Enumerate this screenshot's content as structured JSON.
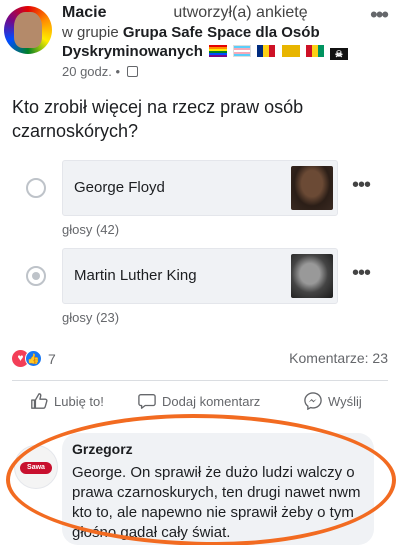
{
  "post": {
    "author_name": "Macie",
    "action_text": "utworzył(a) ankietę",
    "group_prefix": "w grupie",
    "group_name_line1": "Grupa Safe Space dla Osób",
    "group_name_line2": "Dyskryminowanych",
    "group_flags": [
      "rainbow-flag",
      "trans-flag",
      "romania-flag",
      "belgium-flag",
      "guinea-flag",
      "pirate-flag"
    ],
    "time": "20 godz.",
    "separator": "•",
    "question": "Kto zrobił więcej na rzecz praw osób czarnoskórych?"
  },
  "poll": {
    "options": [
      {
        "label": "George Floyd",
        "votes_text": "głosy (42)",
        "selected": false
      },
      {
        "label": "Martin Luther King",
        "votes_text": "głosy (23)",
        "selected": true
      }
    ]
  },
  "stats": {
    "reactions_count": "7",
    "comments_text": "Komentarze: 23"
  },
  "actions": {
    "like_label": "Lubię to!",
    "comment_label": "Dodaj komentarz",
    "share_label": "Wyślij"
  },
  "comment": {
    "author": "Grzegorz",
    "text": "George. On sprawił że dużo ludzi walczy o prawa czarnoskurych, ten drugi nawet nwm kto to, ale napewno nie sprawił żeby o tym głośno gadał cały świat.",
    "avatar_logo_text": "Sawa"
  },
  "colors": {
    "highlight_oval": "#f26b21",
    "like_blue": "#1877f2",
    "love_red": "#f33e58"
  }
}
